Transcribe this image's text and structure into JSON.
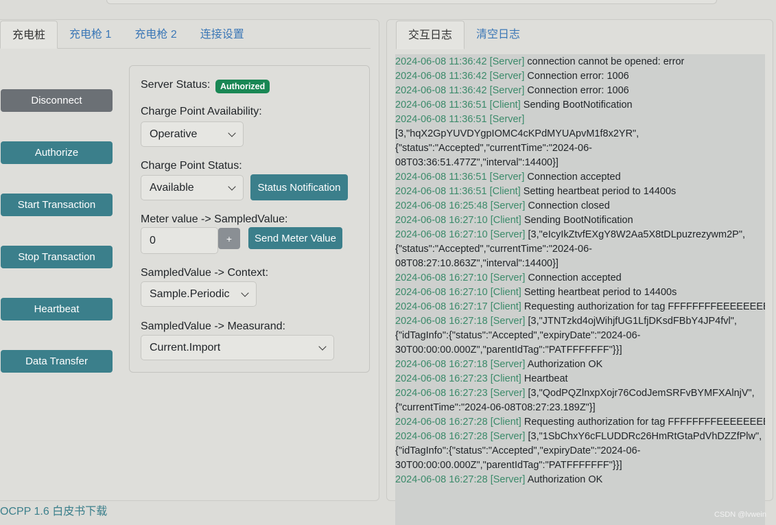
{
  "left_tabs": [
    "充电桩",
    "充电枪 1",
    "充电枪 2",
    "连接设置"
  ],
  "right_tabs": [
    "交互日志",
    "清空日志"
  ],
  "side_buttons": [
    "Disconnect",
    "Authorize",
    "Start Transaction",
    "Stop Transaction",
    "Heartbeat",
    "Data Transfer"
  ],
  "form": {
    "server_status_label": "Server Status:",
    "server_status_badge": "Authorized",
    "availability_label": "Charge Point Availability:",
    "availability_value": "Operative",
    "status_label": "Charge Point Status:",
    "status_value": "Available",
    "status_notification_button": "Status Notification",
    "meter_label": "Meter value -> SampledValue:",
    "meter_value": "0",
    "increment_button": "+",
    "send_meter_button": "Send Meter Value",
    "context_label": "SampledValue -> Context:",
    "context_value": "Sample.Periodic",
    "measurand_label": "SampledValue -> Measurand:",
    "measurand_value": "Current.Import"
  },
  "log_lines": [
    {
      "ts": "2024-06-08 11:36:42",
      "src": "[Server]",
      "msg": "connection cannot be opened: error"
    },
    {
      "ts": "2024-06-08 11:36:42",
      "src": "[Server]",
      "msg": "Connection error: 1006"
    },
    {
      "ts": "2024-06-08 11:36:42",
      "src": "[Server]",
      "msg": "Connection error: 1006"
    },
    {
      "ts": "2024-06-08 11:36:51",
      "src": "[Client]",
      "msg": "Sending BootNotification"
    },
    {
      "ts": "2024-06-08 11:36:51",
      "src": "[Server]",
      "msg": ""
    },
    {
      "ts": "",
      "src": "",
      "msg": "[3,\"hqX2GpYUVDYgpIOMC4cKPdMYUApvM1f8x2YR\","
    },
    {
      "ts": "",
      "src": "",
      "msg": "{\"status\":\"Accepted\",\"currentTime\":\"2024-06-"
    },
    {
      "ts": "",
      "src": "",
      "msg": "08T03:36:51.477Z\",\"interval\":14400}]"
    },
    {
      "ts": "2024-06-08 11:36:51",
      "src": "[Server]",
      "msg": "Connection accepted"
    },
    {
      "ts": "2024-06-08 11:36:51",
      "src": "[Client]",
      "msg": "Setting heartbeat period to 14400s"
    },
    {
      "ts": "2024-06-08 16:25:48",
      "src": "[Server]",
      "msg": "Connection closed"
    },
    {
      "ts": "2024-06-08 16:27:10",
      "src": "[Client]",
      "msg": "Sending BootNotification"
    },
    {
      "ts": "2024-06-08 16:27:10",
      "src": "[Server]",
      "msg": "[3,\"eIcyIkZtvfEXgY8W2Aa5X8tDLpuzrezywm2P\","
    },
    {
      "ts": "",
      "src": "",
      "msg": "{\"status\":\"Accepted\",\"currentTime\":\"2024-06-"
    },
    {
      "ts": "",
      "src": "",
      "msg": "08T08:27:10.863Z\",\"interval\":14400}]"
    },
    {
      "ts": "2024-06-08 16:27:10",
      "src": "[Server]",
      "msg": "Connection accepted"
    },
    {
      "ts": "2024-06-08 16:27:10",
      "src": "[Client]",
      "msg": "Setting heartbeat period to 14400s"
    },
    {
      "ts": "2024-06-08 16:27:17",
      "src": "[Client]",
      "msg": "Requesting authorization for tag FFFFFFFFEEEEEEEE"
    },
    {
      "ts": "2024-06-08 16:27:18",
      "src": "[Server]",
      "msg": "[3,\"JTNTzkd4ojWihjfUG1LfjDKsdFBbY4JP4fvl\","
    },
    {
      "ts": "",
      "src": "",
      "msg": "{\"idTagInfo\":{\"status\":\"Accepted\",\"expiryDate\":\"2024-06-"
    },
    {
      "ts": "",
      "src": "",
      "msg": "30T00:00:00.000Z\",\"parentIdTag\":\"PATFFFFFFF\"}}]"
    },
    {
      "ts": "2024-06-08 16:27:18",
      "src": "[Server]",
      "msg": "Authorization OK"
    },
    {
      "ts": "2024-06-08 16:27:23",
      "src": "[Client]",
      "msg": "Heartbeat"
    },
    {
      "ts": "2024-06-08 16:27:23",
      "src": "[Server]",
      "msg": "[3,\"QodPQZlnxpXojr76CodJemSRFvBYMFXAlnjV\","
    },
    {
      "ts": "",
      "src": "",
      "msg": "{\"currentTime\":\"2024-06-08T08:27:23.189Z\"}]"
    },
    {
      "ts": "2024-06-08 16:27:28",
      "src": "[Client]",
      "msg": "Requesting authorization for tag FFFFFFFFEEEEEEEE"
    },
    {
      "ts": "2024-06-08 16:27:28",
      "src": "[Server]",
      "msg": "[3,\"1SbChxY6cFLUDDRc26HmRtGtaPdVhDZZfPlw\","
    },
    {
      "ts": "",
      "src": "",
      "msg": "{\"idTagInfo\":{\"status\":\"Accepted\",\"expiryDate\":\"2024-06-"
    },
    {
      "ts": "",
      "src": "",
      "msg": "30T00:00:00.000Z\",\"parentIdTag\":\"PATFFFFFFF\"}}]"
    },
    {
      "ts": "2024-06-08 16:27:28",
      "src": "[Server]",
      "msg": "Authorization OK"
    }
  ],
  "footer_link": "OCPP 1.6 白皮书下载",
  "watermark": "CSDN @lvwein"
}
